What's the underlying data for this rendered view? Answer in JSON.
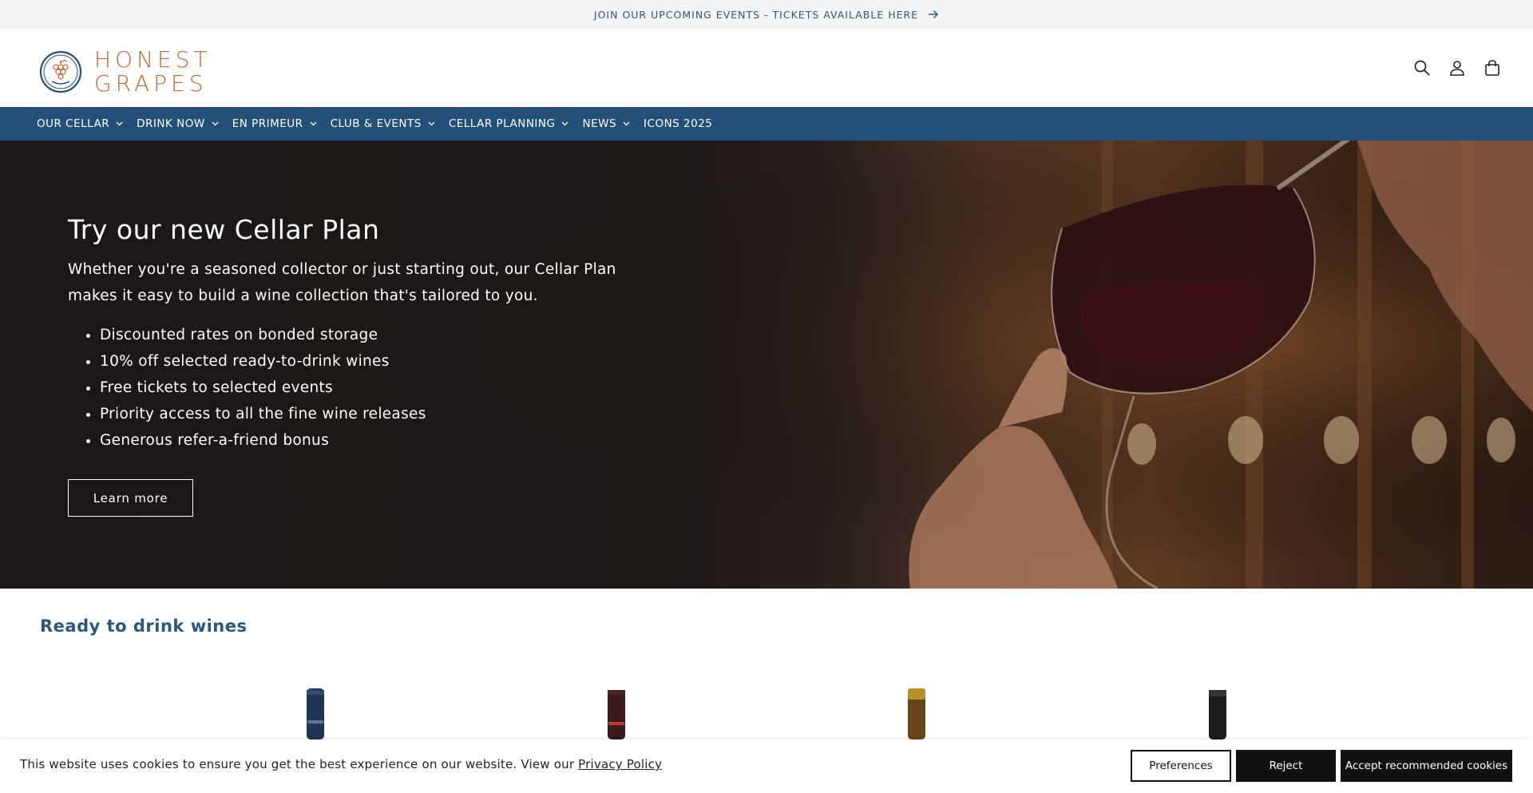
{
  "announcement": {
    "text": "JOIN OUR UPCOMING EVENTS - TICKETS AVAILABLE HERE",
    "icon": "arrow-right-icon"
  },
  "header": {
    "logo_line1": "HONEST",
    "logo_line2": "GRAPES",
    "icons": [
      "search-icon",
      "account-icon",
      "cart-icon"
    ]
  },
  "nav": {
    "items": [
      {
        "label": "OUR CELLAR",
        "dropdown": true
      },
      {
        "label": "DRINK NOW",
        "dropdown": true
      },
      {
        "label": "EN PRIMEUR",
        "dropdown": true
      },
      {
        "label": "CLUB & EVENTS",
        "dropdown": true
      },
      {
        "label": "CELLAR PLANNING",
        "dropdown": true
      },
      {
        "label": "NEWS",
        "dropdown": true
      },
      {
        "label": "ICONS 2025",
        "dropdown": false
      }
    ]
  },
  "hero": {
    "title": "Try our new Cellar Plan",
    "subtitle": "Whether you're a seasoned collector or just starting out, our Cellar Plan makes it easy to build a wine collection that's tailored to you.",
    "bullets": [
      "Discounted rates on bonded storage",
      "10% off selected ready-to-drink wines",
      "Free tickets to selected events",
      "Priority access to all the fine wine releases",
      "Generous refer-a-friend bonus"
    ],
    "button": "Learn more"
  },
  "products": {
    "title": "Ready to drink wines"
  },
  "cookie": {
    "text": "This website uses cookies to ensure you get the best experience on our website. View our",
    "link": "Privacy Policy",
    "preferences": "Preferences",
    "reject": "Reject",
    "accept": "Accept recommended cookies"
  },
  "colors": {
    "nav_bg": "#245077",
    "brand_orange": "#c4653c",
    "brand_blue": "#2c5878",
    "button_dark": "#111111"
  }
}
